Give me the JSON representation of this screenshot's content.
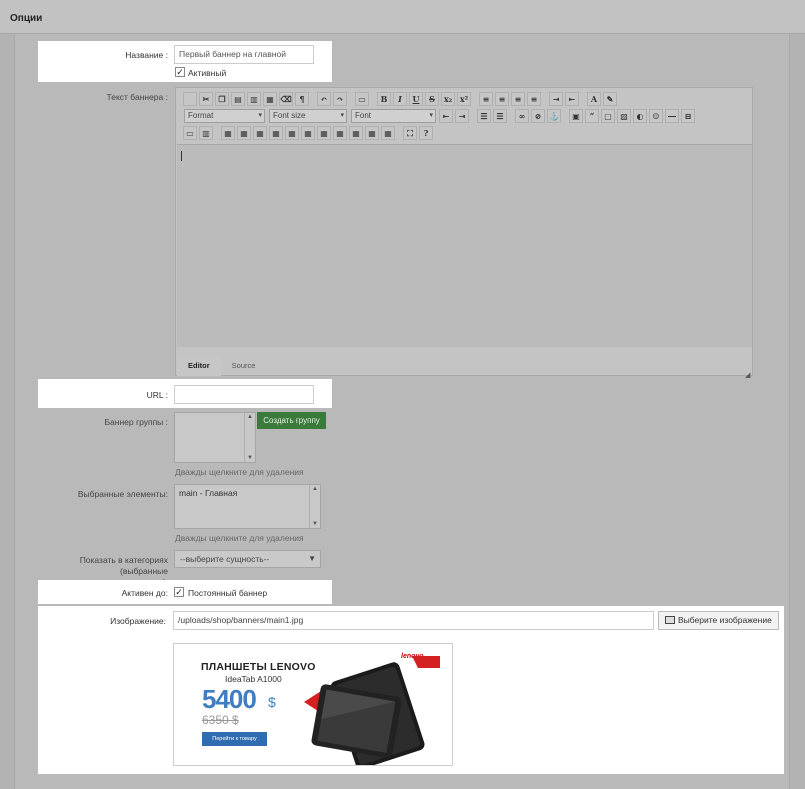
{
  "header": {
    "title": "Опции"
  },
  "form": {
    "name": {
      "label": "Название :",
      "value": "Первый баннер на главной"
    },
    "active": {
      "label": "Активный",
      "checked": true
    },
    "text": {
      "label": "Текст баннера :",
      "format_select": "Format",
      "fontsize_select": "Font size",
      "font_select": "Font",
      "tabs": [
        "Editor",
        "Source"
      ]
    },
    "url": {
      "label": "URL :",
      "value": ""
    },
    "groups": {
      "label": "Баннер группы :",
      "create_button": "Создать группу",
      "hint": "Дважды щелкните для удаления"
    },
    "selected": {
      "label": "Выбранные элементы:",
      "items": [
        "main - Главная"
      ],
      "hint": "Дважды щелкните для удаления"
    },
    "category": {
      "label_line1": "Показать в категориях (выбранные",
      "label_line2": "элементы):",
      "value": "--выберите сущность--"
    },
    "active_until": {
      "label": "Активен до:",
      "checkbox_label": "Постоянный баннер",
      "checked": true
    },
    "image": {
      "label": "Изображение:",
      "path": "/uploads/shop/banners/main1.jpg",
      "button": "Выберите изображение"
    }
  },
  "banner": {
    "title": "ПЛАНШЕТЫ LENOVO",
    "subtitle": "IdeaTab A1000",
    "price": "5400",
    "currency": "$",
    "old_price": "6350 $",
    "button": "Перейти к товару",
    "logo": "lenovo"
  }
}
